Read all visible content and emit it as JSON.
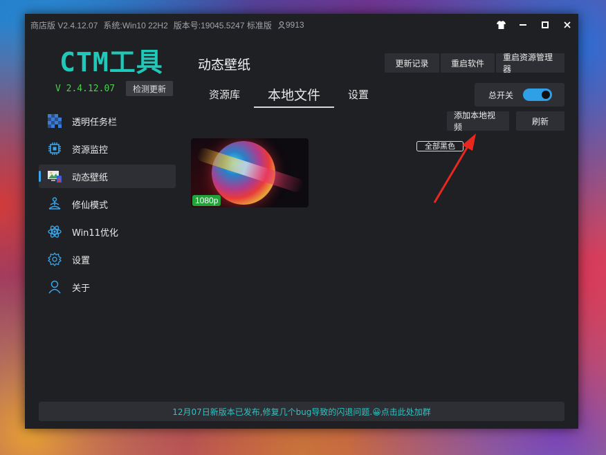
{
  "titlebar": {
    "edition": "商店版 V2.4.12.07",
    "system": "系统:Win10 22H2",
    "build": "版本号:19045.5247 标准版",
    "user_id": "9913"
  },
  "logo": "CTM工具",
  "version": "V 2.4.12.07",
  "check_update": "检测更新",
  "sidebar": {
    "items": [
      {
        "label": "透明任务栏",
        "icon": "taskbar-icon"
      },
      {
        "label": "资源监控",
        "icon": "chip-icon"
      },
      {
        "label": "动态壁纸",
        "icon": "wallpaper-icon"
      },
      {
        "label": "修仙模式",
        "icon": "meditation-icon"
      },
      {
        "label": "Win11优化",
        "icon": "atom-icon"
      },
      {
        "label": "设置",
        "icon": "gear-icon"
      },
      {
        "label": "关于",
        "icon": "user-icon"
      }
    ],
    "active_index": 2
  },
  "page_title": "动态壁纸",
  "top_buttons": {
    "changelog": "更新记录",
    "restart_app": "重启软件",
    "restart_explorer": "重启资源管理器"
  },
  "tabs": [
    {
      "label": "资源库"
    },
    {
      "label": "本地文件"
    },
    {
      "label": "设置"
    }
  ],
  "active_tab": 1,
  "master_switch": {
    "label": "总开关",
    "on": true
  },
  "add_local_video": "添加本地视频",
  "refresh": "刷新",
  "all_black": "全部黑色",
  "wallpaper": {
    "resolution": "1080p"
  },
  "footer": "12月07日新版本已发布,修复几个bug导致的闪退问题.😀点击此处加群",
  "colors": {
    "accent": "#2f9fe6",
    "logo": "#1fc8b8",
    "version": "#4cd04c",
    "footer_text": "#2fc2c2",
    "annotation_arrow": "#e8281e"
  }
}
